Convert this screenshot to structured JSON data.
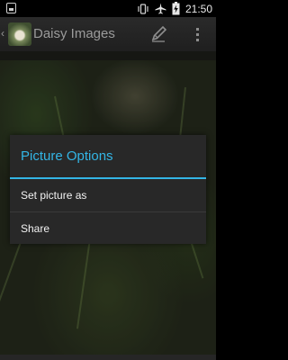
{
  "status_bar": {
    "time": "21:50",
    "icons": [
      "app-notification-icon",
      "vibrate-icon",
      "airplane-mode-icon",
      "battery-charging-icon"
    ]
  },
  "action_bar": {
    "title": "Daisy Images",
    "actions": [
      "edit-icon",
      "overflow-menu-icon"
    ]
  },
  "dialog": {
    "title": "Picture Options",
    "items": [
      {
        "label": "Set picture as"
      },
      {
        "label": "Share"
      }
    ]
  },
  "colors": {
    "accent": "#33b5e5",
    "dialog_bg": "#282828",
    "action_bar_bg": "#222222"
  }
}
